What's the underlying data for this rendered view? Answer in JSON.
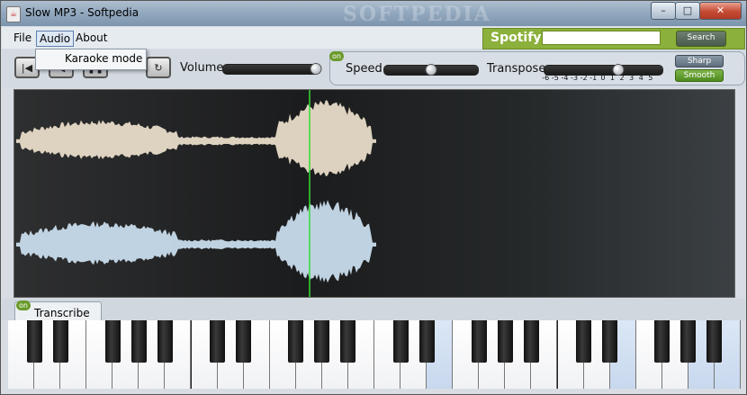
{
  "window": {
    "title": "Slow MP3 - Softpedia",
    "watermark": "SOFTPEDIA",
    "controls": {
      "minimize": "–",
      "maximize": "□",
      "close": "✕"
    }
  },
  "menubar": {
    "items": [
      {
        "label": "File"
      },
      {
        "label": "Audio"
      },
      {
        "label": "About"
      }
    ],
    "audio_dropdown": {
      "items": [
        {
          "label": "Karaoke mode"
        }
      ]
    }
  },
  "spotify": {
    "logo": "Spotify",
    "search_value": "",
    "search_label": "Search",
    "color": "#8bb03b"
  },
  "transport": {
    "buttons": [
      {
        "icon": "skip-back-icon",
        "glyph": "|◀"
      },
      {
        "icon": "rewind-icon",
        "glyph": "◀"
      },
      {
        "icon": "pause-icon",
        "glyph": "❚❚"
      },
      {
        "icon": "loop-icon",
        "glyph": "↻"
      }
    ],
    "volume_label": "Volume",
    "volume_value": 0.96
  },
  "effects": {
    "on_label": "on",
    "speed_label": "Speed",
    "speed_value": 0.5,
    "transpose_label": "Transpose",
    "transpose_value": 1,
    "transpose_ticks": [
      "-6",
      "-5",
      "-4",
      "-3",
      "-2",
      "-1",
      "0",
      "1",
      "2",
      "3",
      "4",
      "5"
    ],
    "sharp_label": "Sharp",
    "smooth_label": "Smooth",
    "active_mode": "Smooth"
  },
  "waveform": {
    "playhead_fraction": 0.41,
    "playhead_color": "#33dd33",
    "top_channel_color": "#e8dcc8",
    "bottom_channel_color": "#c8dcec"
  },
  "transcribe": {
    "on_label": "on",
    "tab_label": "Transcribe"
  },
  "piano": {
    "white_key_count": 28,
    "highlighted_white_keys": [
      16,
      23,
      26,
      27
    ],
    "highlight_color": "#c8d8ee"
  }
}
